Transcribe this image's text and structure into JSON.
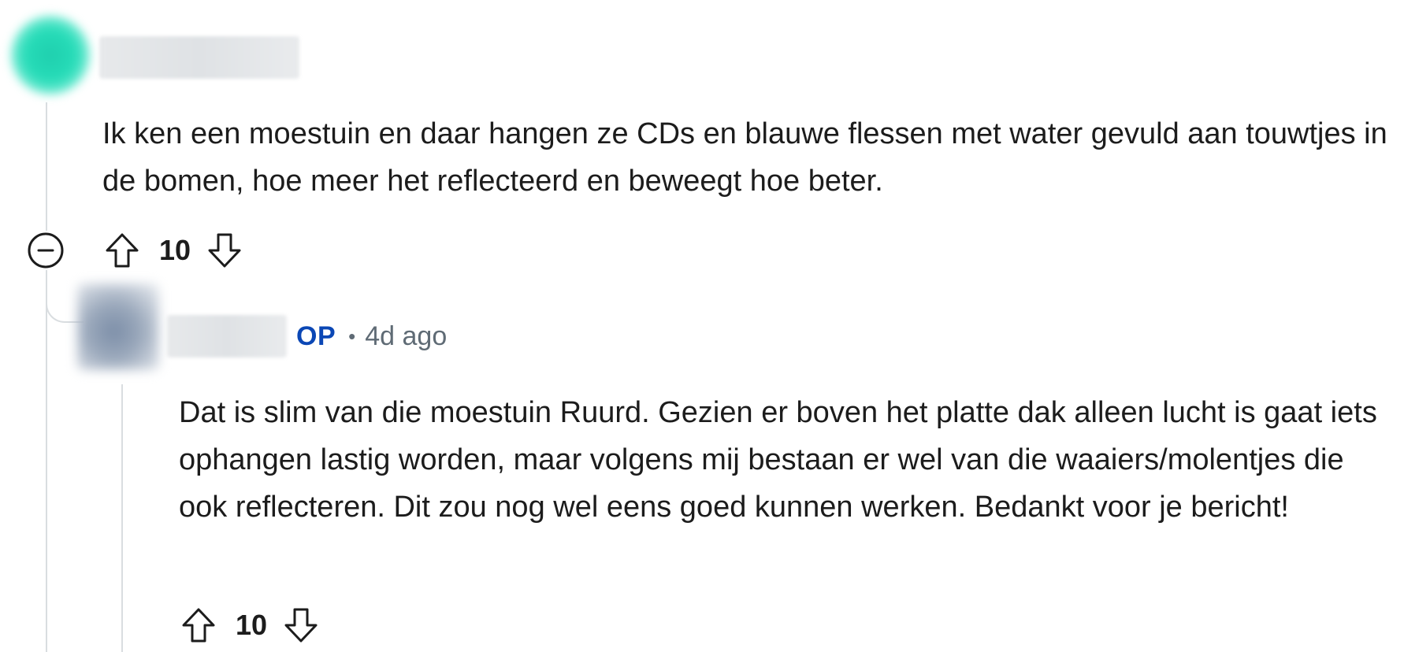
{
  "comment": {
    "body": "Ik ken een moestuin en daar hangen ze CDs en blauwe flessen met water gevuld aan touwtjes in de bomen, hoe meer het reflecteerd en beweegt hoe beter.",
    "score": "10",
    "avatar_color": "#26dcb8",
    "icons": {
      "collapse": "minus-circle-icon",
      "upvote": "arrow-up-icon",
      "downvote": "arrow-down-icon"
    }
  },
  "reply": {
    "op_badge": "OP",
    "separator": "•",
    "timestamp": "4d ago",
    "body": "Dat is slim van die moestuin Ruurd. Gezien er boven het platte dak alleen lucht is gaat iets ophangen lastig worden, maar volgens mij bestaan er wel van die waaiers/molentjes die ook reflecteren. Dit zou nog wel eens goed kunnen werken. Bedankt voor je bericht!",
    "score": "10",
    "op_color": "#0b47b5"
  },
  "colors": {
    "thread_line": "#d9dde0",
    "meta_text": "#5f6b75",
    "body_text": "#1c1c1c"
  }
}
